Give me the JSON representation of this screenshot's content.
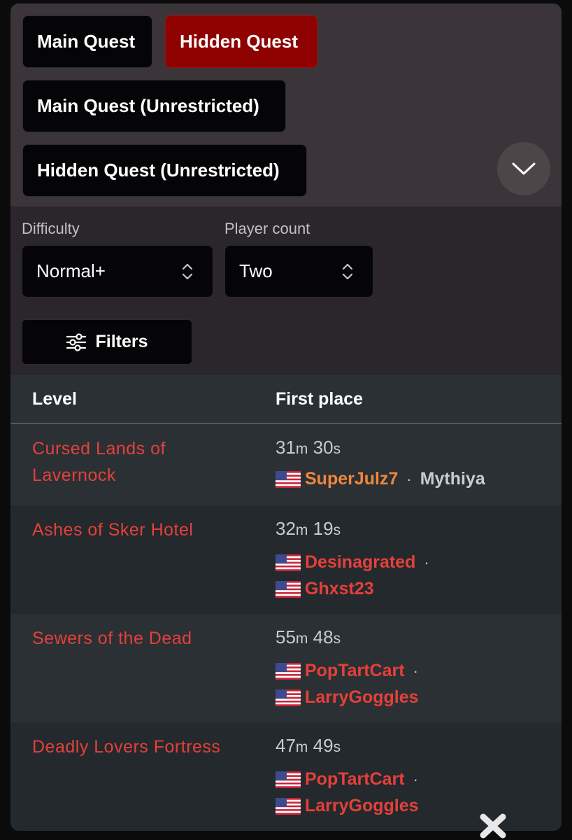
{
  "quest_tabs": [
    {
      "label": "Main Quest",
      "active": false
    },
    {
      "label": "Hidden Quest",
      "active": true
    },
    {
      "label": "Main Quest (Unrestricted)",
      "active": false
    },
    {
      "label": "Hidden Quest (Unrestricted)",
      "active": false
    }
  ],
  "collapse_icon": "chevron-down-icon",
  "difficulty": {
    "label": "Difficulty",
    "value": "Normal+"
  },
  "player_count": {
    "label": "Player count",
    "value": "Two"
  },
  "filters_button": {
    "label": "Filters",
    "icon": "sliders-icon"
  },
  "table": {
    "headers": {
      "level": "Level",
      "first_place": "First place"
    },
    "rows": [
      {
        "level": "Cursed Lands of Lavernock",
        "time": {
          "m": "31",
          "m_unit": "m",
          "s": "30",
          "s_unit": "s"
        },
        "players": [
          {
            "flag": "us-flag-icon",
            "name": "SuperJulz7",
            "color": "#f0863c"
          },
          {
            "flag": "",
            "name": "Mythiya",
            "color": "#c9cbcd"
          }
        ]
      },
      {
        "level": "Ashes of Sker Hotel",
        "time": {
          "m": "32",
          "m_unit": "m",
          "s": "19",
          "s_unit": "s"
        },
        "players": [
          {
            "flag": "us-flag-icon",
            "name": "Desinagrated",
            "color": "#e5403a"
          },
          {
            "flag": "us-flag-icon",
            "name": "Ghxst23",
            "color": "#e5403a"
          }
        ]
      },
      {
        "level": "Sewers of the Dead",
        "time": {
          "m": "55",
          "m_unit": "m",
          "s": "48",
          "s_unit": "s"
        },
        "players": [
          {
            "flag": "us-flag-icon",
            "name": "PopTartCart",
            "color": "#e5403a"
          },
          {
            "flag": "us-flag-icon",
            "name": "LarryGoggles",
            "color": "#e5403a"
          }
        ]
      },
      {
        "level": "Deadly Lovers Fortress",
        "time": {
          "m": "47",
          "m_unit": "m",
          "s": "49",
          "s_unit": "s"
        },
        "players": [
          {
            "flag": "us-flag-icon",
            "name": "PopTartCart",
            "color": "#e5403a"
          },
          {
            "flag": "us-flag-icon",
            "name": "LarryGoggles",
            "color": "#e5403a"
          }
        ]
      }
    ]
  },
  "separator": "·",
  "colors": {
    "accent_red": "#e5403a",
    "active_tab": "#8e0202",
    "highlight_orange": "#f0863c"
  }
}
